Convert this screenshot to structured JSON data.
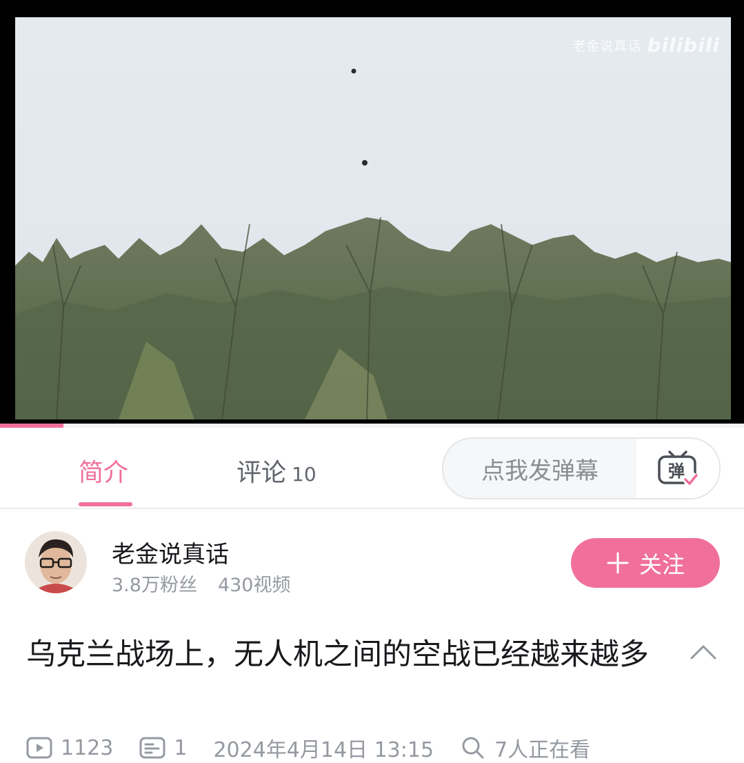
{
  "video": {
    "watermark_text": "老金说真话",
    "watermark_logo": "bilibili",
    "progress_fraction": 0.085,
    "accent_color": "#f0709b"
  },
  "tabs": [
    {
      "label": "简介",
      "count": "",
      "active": true
    },
    {
      "label": "评论",
      "count": "10",
      "active": false
    }
  ],
  "danmaku": {
    "placeholder": "点我发弹幕",
    "button_icon": "danmaku-toggle-icon",
    "button_glyph": "弹"
  },
  "uploader": {
    "name": "老金说真话",
    "followers": "3.8万粉丝",
    "videos": "430视频",
    "follow_label": "关注",
    "follow_icon": "plus-icon"
  },
  "title": "乌克兰战场上，无人机之间的空战已经越来越多",
  "meta": {
    "plays": "1123",
    "danmaku_count": "1",
    "date": "2024年4月14日 13:15",
    "watching": "7人正在看"
  }
}
